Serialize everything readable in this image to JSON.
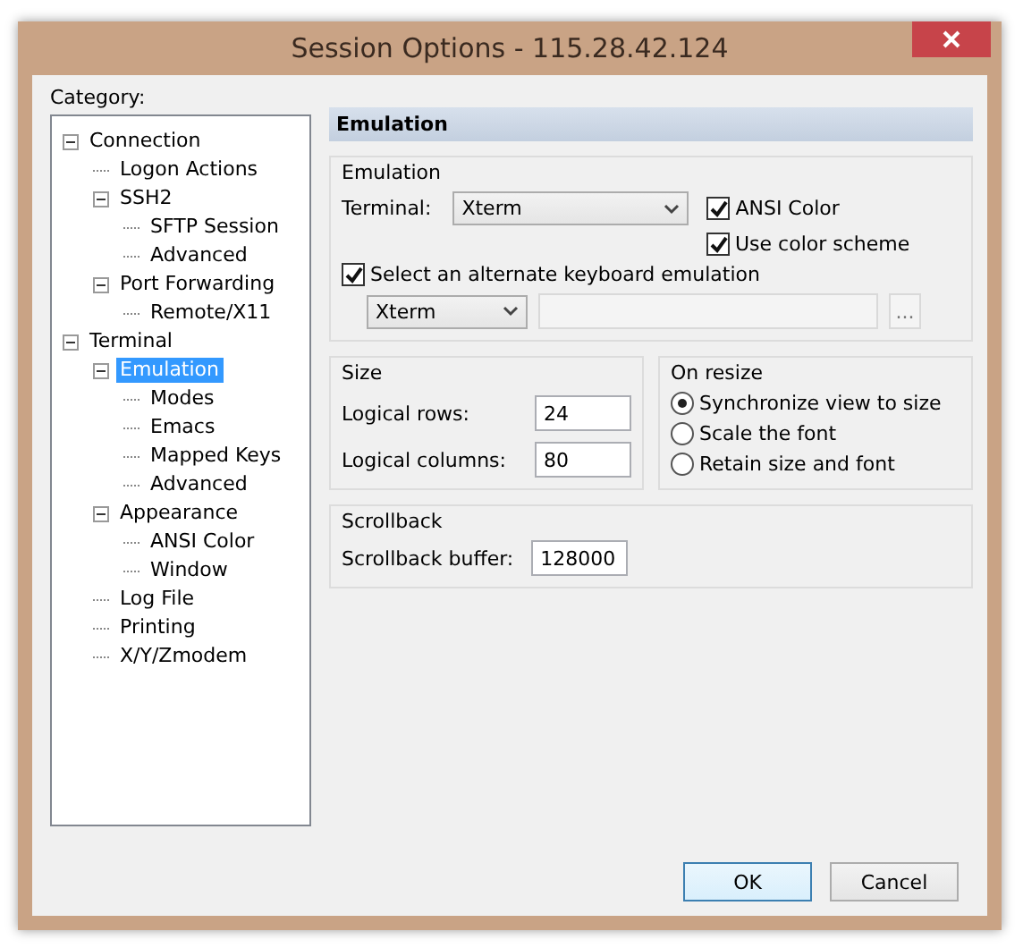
{
  "window": {
    "title": "Session Options - 115.28.42.124"
  },
  "category_label": "Category:",
  "tree": [
    {
      "label": "Connection",
      "expanded": true,
      "selected": false,
      "children": [
        {
          "label": "Logon Actions",
          "selected": false
        },
        {
          "label": "SSH2",
          "expanded": true,
          "selected": false,
          "children": [
            {
              "label": "SFTP Session",
              "selected": false
            },
            {
              "label": "Advanced",
              "selected": false
            }
          ]
        },
        {
          "label": "Port Forwarding",
          "expanded": true,
          "selected": false,
          "children": [
            {
              "label": "Remote/X11",
              "selected": false
            }
          ]
        }
      ]
    },
    {
      "label": "Terminal",
      "expanded": true,
      "selected": false,
      "children": [
        {
          "label": "Emulation",
          "expanded": true,
          "selected": true,
          "children": [
            {
              "label": "Modes",
              "selected": false
            },
            {
              "label": "Emacs",
              "selected": false
            },
            {
              "label": "Mapped Keys",
              "selected": false
            },
            {
              "label": "Advanced",
              "selected": false
            }
          ]
        },
        {
          "label": "Appearance",
          "expanded": true,
          "selected": false,
          "children": [
            {
              "label": "ANSI Color",
              "selected": false
            },
            {
              "label": "Window",
              "selected": false
            }
          ]
        },
        {
          "label": "Log File",
          "selected": false
        },
        {
          "label": "Printing",
          "selected": false
        },
        {
          "label": "X/Y/Zmodem",
          "selected": false
        }
      ]
    }
  ],
  "panel_header": "Emulation",
  "emulation": {
    "title": "Emulation",
    "terminal_label": "Terminal:",
    "terminal_value": "Xterm",
    "ansi_color": {
      "label": "ANSI Color",
      "checked": true
    },
    "use_color_scheme": {
      "label": "Use color scheme",
      "checked": true
    },
    "alternate_keyboard": {
      "label": "Select an alternate keyboard emulation",
      "checked": true
    },
    "keyboard_value": "Xterm",
    "keyboard_file": {
      "disabled": true
    },
    "browse_button": {
      "label": "...",
      "disabled": true
    }
  },
  "size": {
    "title": "Size",
    "rows_label": "Logical rows:",
    "rows_value": "24",
    "columns_label": "Logical columns:",
    "columns_value": "80"
  },
  "on_resize": {
    "title": "On resize",
    "options": [
      {
        "label": "Synchronize view to size",
        "selected": true
      },
      {
        "label": "Scale the font",
        "selected": false
      },
      {
        "label": "Retain size and font",
        "selected": false
      }
    ]
  },
  "scrollback": {
    "title": "Scrollback",
    "buffer_label": "Scrollback buffer:",
    "buffer_value": "128000"
  },
  "buttons": [
    {
      "label": "OK",
      "default": true
    },
    {
      "label": "Cancel",
      "default": false
    }
  ]
}
